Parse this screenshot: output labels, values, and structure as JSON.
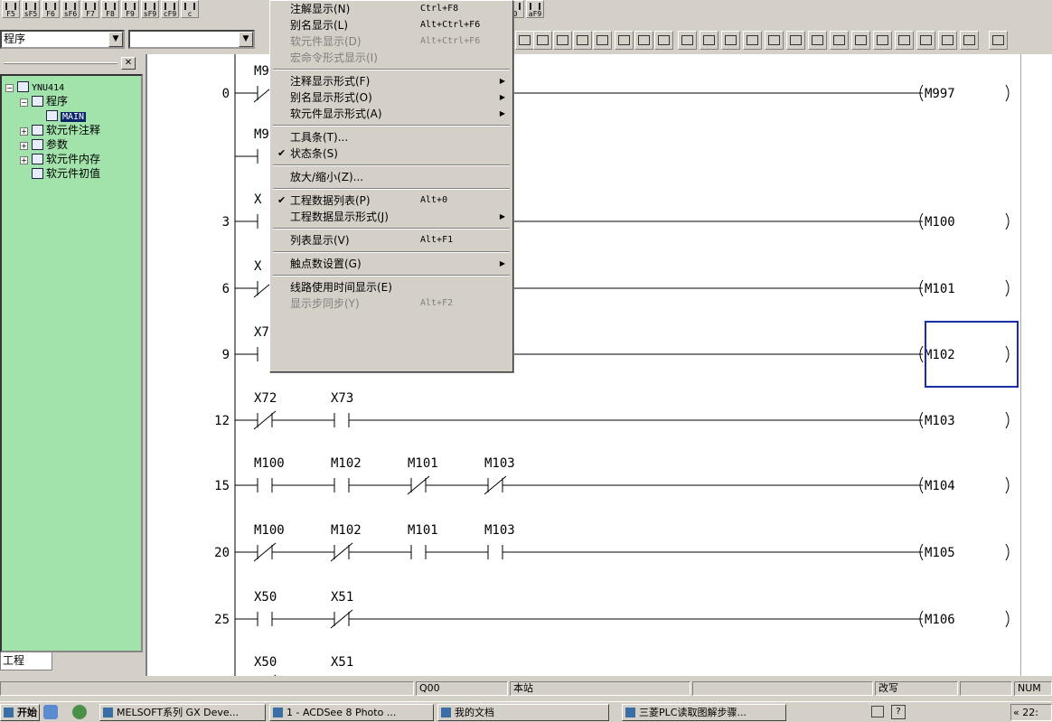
{
  "fkey_toolbar": {
    "buttons": [
      "F5",
      "sF5",
      "F6",
      "sF6",
      "F7",
      "F8",
      "F9",
      "sF9",
      "cF9",
      "c",
      "0",
      "aF9"
    ]
  },
  "toolbar2": {
    "combo1_value": "程序",
    "combo2_value": ""
  },
  "project_panel": {
    "close_label": "✕",
    "tree": [
      {
        "label": "YNU414",
        "level": 0,
        "toggle": "−",
        "icon": "plc-icon"
      },
      {
        "label": "程序",
        "level": 1,
        "toggle": "−",
        "icon": "program-folder-icon"
      },
      {
        "label": "MAIN",
        "level": 2,
        "toggle": "",
        "icon": "program-file-icon",
        "selected": true
      },
      {
        "label": "软元件注释",
        "level": 1,
        "toggle": "+",
        "icon": "comment-icon"
      },
      {
        "label": "参数",
        "level": 1,
        "toggle": "+",
        "icon": "parameter-icon"
      },
      {
        "label": "软元件内存",
        "level": 1,
        "toggle": "+",
        "icon": "device-memory-icon"
      },
      {
        "label": "软元件初值",
        "level": 1,
        "toggle": "",
        "icon": "device-init-icon"
      }
    ],
    "tab_label": "工程"
  },
  "ladder": {
    "rungs": [
      {
        "step": "0",
        "contacts": [
          {
            "label": "M9",
            "type": "nc"
          }
        ],
        "coil": "M997"
      },
      {
        "step": "",
        "contacts": [
          {
            "label": "M9",
            "type": "no"
          }
        ],
        "coil": ""
      },
      {
        "step": "3",
        "contacts": [
          {
            "label": "X",
            "type": "no"
          }
        ],
        "coil": "M100"
      },
      {
        "step": "6",
        "contacts": [
          {
            "label": "X",
            "type": "nc"
          }
        ],
        "coil": "M101"
      },
      {
        "step": "9",
        "contacts": [
          {
            "label": "X7",
            "type": "no"
          }
        ],
        "coil": "M102",
        "cursor": true
      },
      {
        "step": "12",
        "contacts": [
          {
            "label": "X72",
            "type": "nc"
          },
          {
            "label": "X73",
            "type": "no"
          }
        ],
        "coil": "M103"
      },
      {
        "step": "15",
        "contacts": [
          {
            "label": "M100",
            "type": "no"
          },
          {
            "label": "M102",
            "type": "no"
          },
          {
            "label": "M101",
            "type": "nc"
          },
          {
            "label": "M103",
            "type": "nc"
          }
        ],
        "coil": "M104"
      },
      {
        "step": "20",
        "contacts": [
          {
            "label": "M100",
            "type": "nc"
          },
          {
            "label": "M102",
            "type": "nc"
          },
          {
            "label": "M101",
            "type": "no"
          },
          {
            "label": "M103",
            "type": "no"
          }
        ],
        "coil": "M105"
      },
      {
        "step": "25",
        "contacts": [
          {
            "label": "X50",
            "type": "no"
          },
          {
            "label": "X51",
            "type": "nc"
          }
        ],
        "coil": "M106"
      },
      {
        "step": "",
        "contacts": [
          {
            "label": "X50",
            "type": "nc"
          },
          {
            "label": "X51",
            "type": "no"
          }
        ],
        "coil": ""
      }
    ]
  },
  "view_menu": {
    "items": [
      {
        "label": "注解显示(N)",
        "shortcut": "Ctrl+F8",
        "disabled": false,
        "checked": false,
        "submenu": false
      },
      {
        "label": "别名显示(L)",
        "shortcut": "Alt+Ctrl+F6",
        "disabled": false,
        "checked": false,
        "submenu": false
      },
      {
        "label": "软元件显示(D)",
        "shortcut": "Alt+Ctrl+F6",
        "disabled": true,
        "checked": false,
        "submenu": false
      },
      {
        "label": "宏命令形式显示(I)",
        "shortcut": "",
        "disabled": true,
        "checked": false,
        "submenu": false
      },
      {
        "sep": true
      },
      {
        "label": "注释显示形式(F)",
        "shortcut": "",
        "disabled": false,
        "checked": false,
        "submenu": true
      },
      {
        "label": "别名显示形式(O)",
        "shortcut": "",
        "disabled": false,
        "checked": false,
        "submenu": true
      },
      {
        "label": "软元件显示形式(A)",
        "shortcut": "",
        "disabled": false,
        "checked": false,
        "submenu": true
      },
      {
        "sep": true
      },
      {
        "label": "工具条(T)...",
        "shortcut": "",
        "disabled": false,
        "checked": false,
        "submenu": false
      },
      {
        "label": "状态条(S)",
        "shortcut": "",
        "disabled": false,
        "checked": true,
        "submenu": false
      },
      {
        "sep": true
      },
      {
        "label": "放大/缩小(Z)...",
        "shortcut": "",
        "disabled": false,
        "checked": false,
        "submenu": false
      },
      {
        "sep": true
      },
      {
        "label": "工程数据列表(P)",
        "shortcut": "Alt+0",
        "disabled": false,
        "checked": true,
        "submenu": false
      },
      {
        "label": "工程数据显示形式(J)",
        "shortcut": "",
        "disabled": false,
        "checked": false,
        "submenu": true
      },
      {
        "sep": true
      },
      {
        "label": "列表显示(V)",
        "shortcut": "Alt+F1",
        "disabled": false,
        "checked": false,
        "submenu": false
      },
      {
        "sep": true
      },
      {
        "label": "触点数设置(G)",
        "shortcut": "",
        "disabled": false,
        "checked": false,
        "submenu": true
      },
      {
        "sep": true
      },
      {
        "label": "线路使用时间显示(E)",
        "shortcut": "",
        "disabled": false,
        "checked": false,
        "submenu": false
      },
      {
        "label": "显示步同步(Y)",
        "shortcut": "Alt+F2",
        "disabled": true,
        "checked": false,
        "submenu": false
      }
    ]
  },
  "statusbar": {
    "cpu": "Q00",
    "station": "本站",
    "mode": "改写",
    "num": "NUM"
  },
  "taskbar": {
    "start": "开始",
    "tasks": [
      "MELSOFT系列 GX Deve...",
      "1 - ACDSee 8 Photo ...",
      "我的文档",
      "三菱PLC读取图解步骤..."
    ],
    "clock": "22:"
  }
}
